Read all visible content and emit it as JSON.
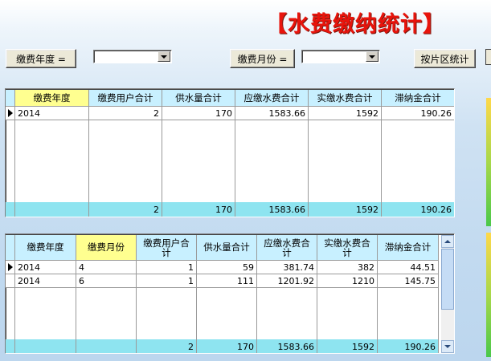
{
  "title": "【水费缴纳统计】",
  "toolbar": {
    "year_button": "缴费年度 =",
    "year_value": "",
    "month_button": "缴费月份 =",
    "month_value": "",
    "district_button": "按片区统计"
  },
  "grid1": {
    "headers": [
      "缴费年度",
      "缴费用户合计",
      "供水量合计",
      "应缴水费合计",
      "实缴水费合计",
      "滞纳金合计"
    ],
    "rows": [
      [
        "2014",
        "2",
        "170",
        "1583.66",
        "1592",
        "190.26"
      ]
    ],
    "footer": [
      "",
      "2",
      "170",
      "1583.66",
      "1592",
      "190.26"
    ]
  },
  "grid2": {
    "headers": [
      "缴费年度",
      "缴费月份",
      "缴费用户合计",
      "供水量合计",
      "应缴水费合计",
      "实缴水费合计",
      "滞纳金合计"
    ],
    "rows": [
      [
        "2014",
        "4",
        "1",
        "59",
        "381.74",
        "382",
        "44.51"
      ],
      [
        "2014",
        "6",
        "1",
        "111",
        "1201.92",
        "1210",
        "145.75"
      ]
    ],
    "footer": [
      "",
      "",
      "2",
      "170",
      "1583.66",
      "1592",
      "190.26"
    ]
  },
  "colors": {
    "title": "#e8140c",
    "header_bg": "#c8f0ff",
    "header_highlight": "#ffff90",
    "footer_bg": "#8ee4f0"
  }
}
